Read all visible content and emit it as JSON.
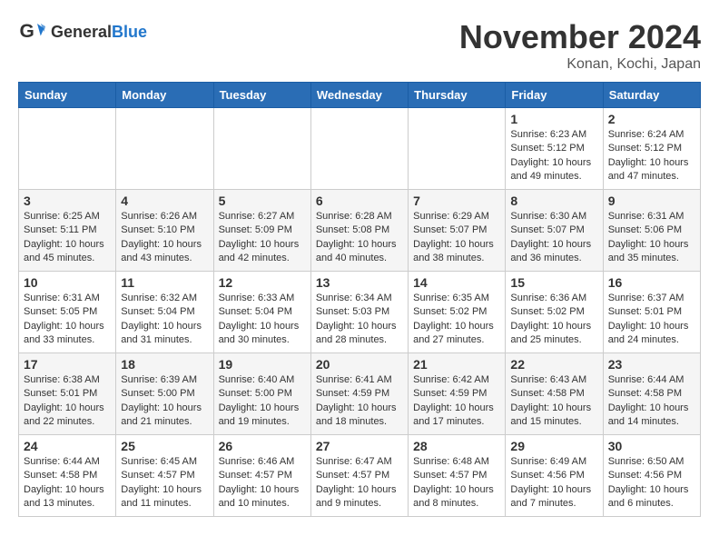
{
  "header": {
    "logo_general": "General",
    "logo_blue": "Blue",
    "title": "November 2024",
    "location": "Konan, Kochi, Japan"
  },
  "weekdays": [
    "Sunday",
    "Monday",
    "Tuesday",
    "Wednesday",
    "Thursday",
    "Friday",
    "Saturday"
  ],
  "weeks": [
    [
      {
        "day": "",
        "info": ""
      },
      {
        "day": "",
        "info": ""
      },
      {
        "day": "",
        "info": ""
      },
      {
        "day": "",
        "info": ""
      },
      {
        "day": "",
        "info": ""
      },
      {
        "day": "1",
        "info": "Sunrise: 6:23 AM\nSunset: 5:12 PM\nDaylight: 10 hours\nand 49 minutes."
      },
      {
        "day": "2",
        "info": "Sunrise: 6:24 AM\nSunset: 5:12 PM\nDaylight: 10 hours\nand 47 minutes."
      }
    ],
    [
      {
        "day": "3",
        "info": "Sunrise: 6:25 AM\nSunset: 5:11 PM\nDaylight: 10 hours\nand 45 minutes."
      },
      {
        "day": "4",
        "info": "Sunrise: 6:26 AM\nSunset: 5:10 PM\nDaylight: 10 hours\nand 43 minutes."
      },
      {
        "day": "5",
        "info": "Sunrise: 6:27 AM\nSunset: 5:09 PM\nDaylight: 10 hours\nand 42 minutes."
      },
      {
        "day": "6",
        "info": "Sunrise: 6:28 AM\nSunset: 5:08 PM\nDaylight: 10 hours\nand 40 minutes."
      },
      {
        "day": "7",
        "info": "Sunrise: 6:29 AM\nSunset: 5:07 PM\nDaylight: 10 hours\nand 38 minutes."
      },
      {
        "day": "8",
        "info": "Sunrise: 6:30 AM\nSunset: 5:07 PM\nDaylight: 10 hours\nand 36 minutes."
      },
      {
        "day": "9",
        "info": "Sunrise: 6:31 AM\nSunset: 5:06 PM\nDaylight: 10 hours\nand 35 minutes."
      }
    ],
    [
      {
        "day": "10",
        "info": "Sunrise: 6:31 AM\nSunset: 5:05 PM\nDaylight: 10 hours\nand 33 minutes."
      },
      {
        "day": "11",
        "info": "Sunrise: 6:32 AM\nSunset: 5:04 PM\nDaylight: 10 hours\nand 31 minutes."
      },
      {
        "day": "12",
        "info": "Sunrise: 6:33 AM\nSunset: 5:04 PM\nDaylight: 10 hours\nand 30 minutes."
      },
      {
        "day": "13",
        "info": "Sunrise: 6:34 AM\nSunset: 5:03 PM\nDaylight: 10 hours\nand 28 minutes."
      },
      {
        "day": "14",
        "info": "Sunrise: 6:35 AM\nSunset: 5:02 PM\nDaylight: 10 hours\nand 27 minutes."
      },
      {
        "day": "15",
        "info": "Sunrise: 6:36 AM\nSunset: 5:02 PM\nDaylight: 10 hours\nand 25 minutes."
      },
      {
        "day": "16",
        "info": "Sunrise: 6:37 AM\nSunset: 5:01 PM\nDaylight: 10 hours\nand 24 minutes."
      }
    ],
    [
      {
        "day": "17",
        "info": "Sunrise: 6:38 AM\nSunset: 5:01 PM\nDaylight: 10 hours\nand 22 minutes."
      },
      {
        "day": "18",
        "info": "Sunrise: 6:39 AM\nSunset: 5:00 PM\nDaylight: 10 hours\nand 21 minutes."
      },
      {
        "day": "19",
        "info": "Sunrise: 6:40 AM\nSunset: 5:00 PM\nDaylight: 10 hours\nand 19 minutes."
      },
      {
        "day": "20",
        "info": "Sunrise: 6:41 AM\nSunset: 4:59 PM\nDaylight: 10 hours\nand 18 minutes."
      },
      {
        "day": "21",
        "info": "Sunrise: 6:42 AM\nSunset: 4:59 PM\nDaylight: 10 hours\nand 17 minutes."
      },
      {
        "day": "22",
        "info": "Sunrise: 6:43 AM\nSunset: 4:58 PM\nDaylight: 10 hours\nand 15 minutes."
      },
      {
        "day": "23",
        "info": "Sunrise: 6:44 AM\nSunset: 4:58 PM\nDaylight: 10 hours\nand 14 minutes."
      }
    ],
    [
      {
        "day": "24",
        "info": "Sunrise: 6:44 AM\nSunset: 4:58 PM\nDaylight: 10 hours\nand 13 minutes."
      },
      {
        "day": "25",
        "info": "Sunrise: 6:45 AM\nSunset: 4:57 PM\nDaylight: 10 hours\nand 11 minutes."
      },
      {
        "day": "26",
        "info": "Sunrise: 6:46 AM\nSunset: 4:57 PM\nDaylight: 10 hours\nand 10 minutes."
      },
      {
        "day": "27",
        "info": "Sunrise: 6:47 AM\nSunset: 4:57 PM\nDaylight: 10 hours\nand 9 minutes."
      },
      {
        "day": "28",
        "info": "Sunrise: 6:48 AM\nSunset: 4:57 PM\nDaylight: 10 hours\nand 8 minutes."
      },
      {
        "day": "29",
        "info": "Sunrise: 6:49 AM\nSunset: 4:56 PM\nDaylight: 10 hours\nand 7 minutes."
      },
      {
        "day": "30",
        "info": "Sunrise: 6:50 AM\nSunset: 4:56 PM\nDaylight: 10 hours\nand 6 minutes."
      }
    ]
  ]
}
